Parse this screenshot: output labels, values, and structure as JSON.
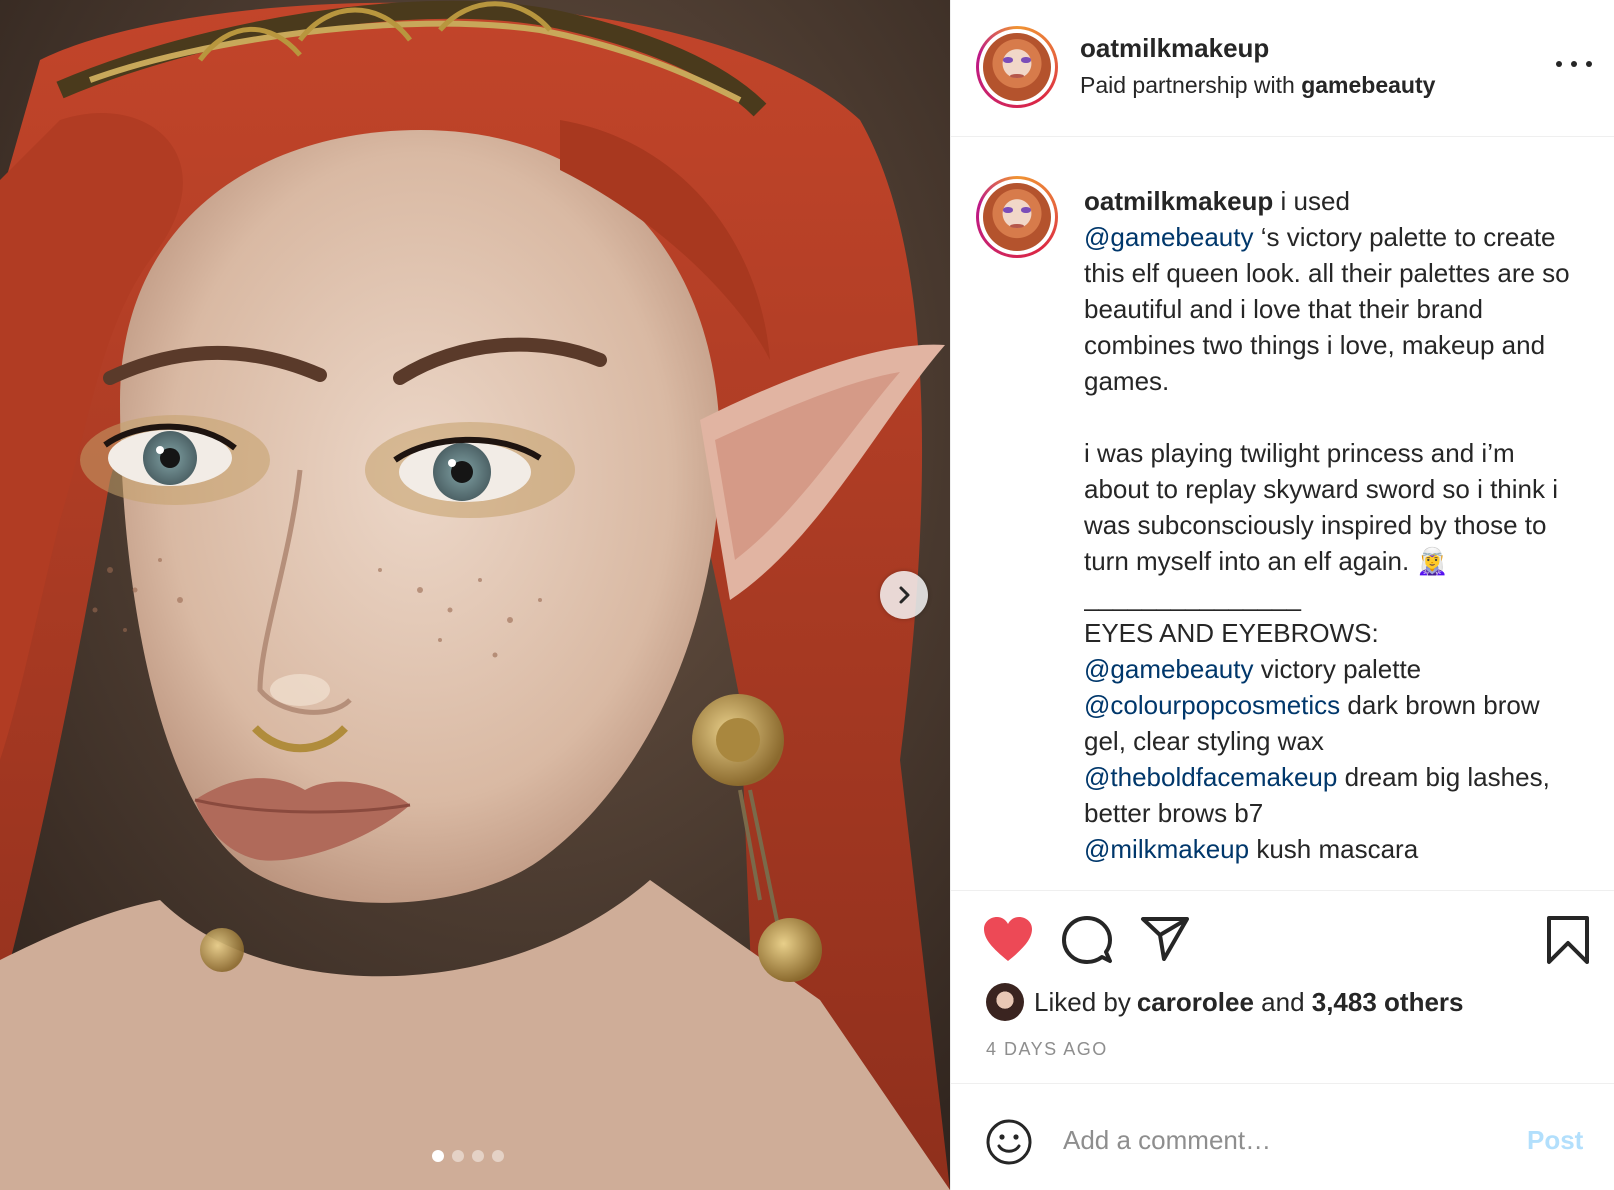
{
  "media": {
    "carousel": {
      "total_slides": 4,
      "active_index": 0
    },
    "next_icon": "chevron-right-icon"
  },
  "header": {
    "username": "oatmilkmakeup",
    "subline_prefix": "Paid partnership with ",
    "partner": "gamebeauty",
    "more_icon": "more-horizontal-icon"
  },
  "caption": {
    "username": "oatmilkmakeup",
    "t1": " i used\n",
    "m1": "@gamebeauty",
    "t2": " ‘s victory palette to create this elf queen look. all their palettes are so beautiful and i love that their brand combines two things i love, makeup and games.\n\ni was playing twilight princess and i’m about to replay skyward sword so i think i was subconsciously inspired by those to turn myself into an elf again. 🧝‍♀️\n_______________\nEYES AND EYEBROWS:\n",
    "m2": "@gamebeauty",
    "t3": " victory palette\n",
    "m3": "@colourpopcosmetics",
    "t4": " dark brown brow gel, clear styling wax\n",
    "m4": "@theboldfacemakeup",
    "t5": " dream big lashes, better brows b7\n",
    "m5": "@milkmakeup",
    "t6": " kush mascara"
  },
  "actions": {
    "like_icon": "heart-filled-icon",
    "comment_icon": "comment-icon",
    "share_icon": "send-icon",
    "save_icon": "bookmark-icon",
    "like_color": "#ed4956"
  },
  "likes": {
    "prefix": "Liked by ",
    "user": "carorolee",
    "middle": " and ",
    "count": "3,483 others"
  },
  "timestamp": "4 DAYS AGO",
  "comment": {
    "emoji_icon": "smiley-icon",
    "placeholder": "Add a comment…",
    "post_label": "Post",
    "post_color": "#b2dffc"
  }
}
